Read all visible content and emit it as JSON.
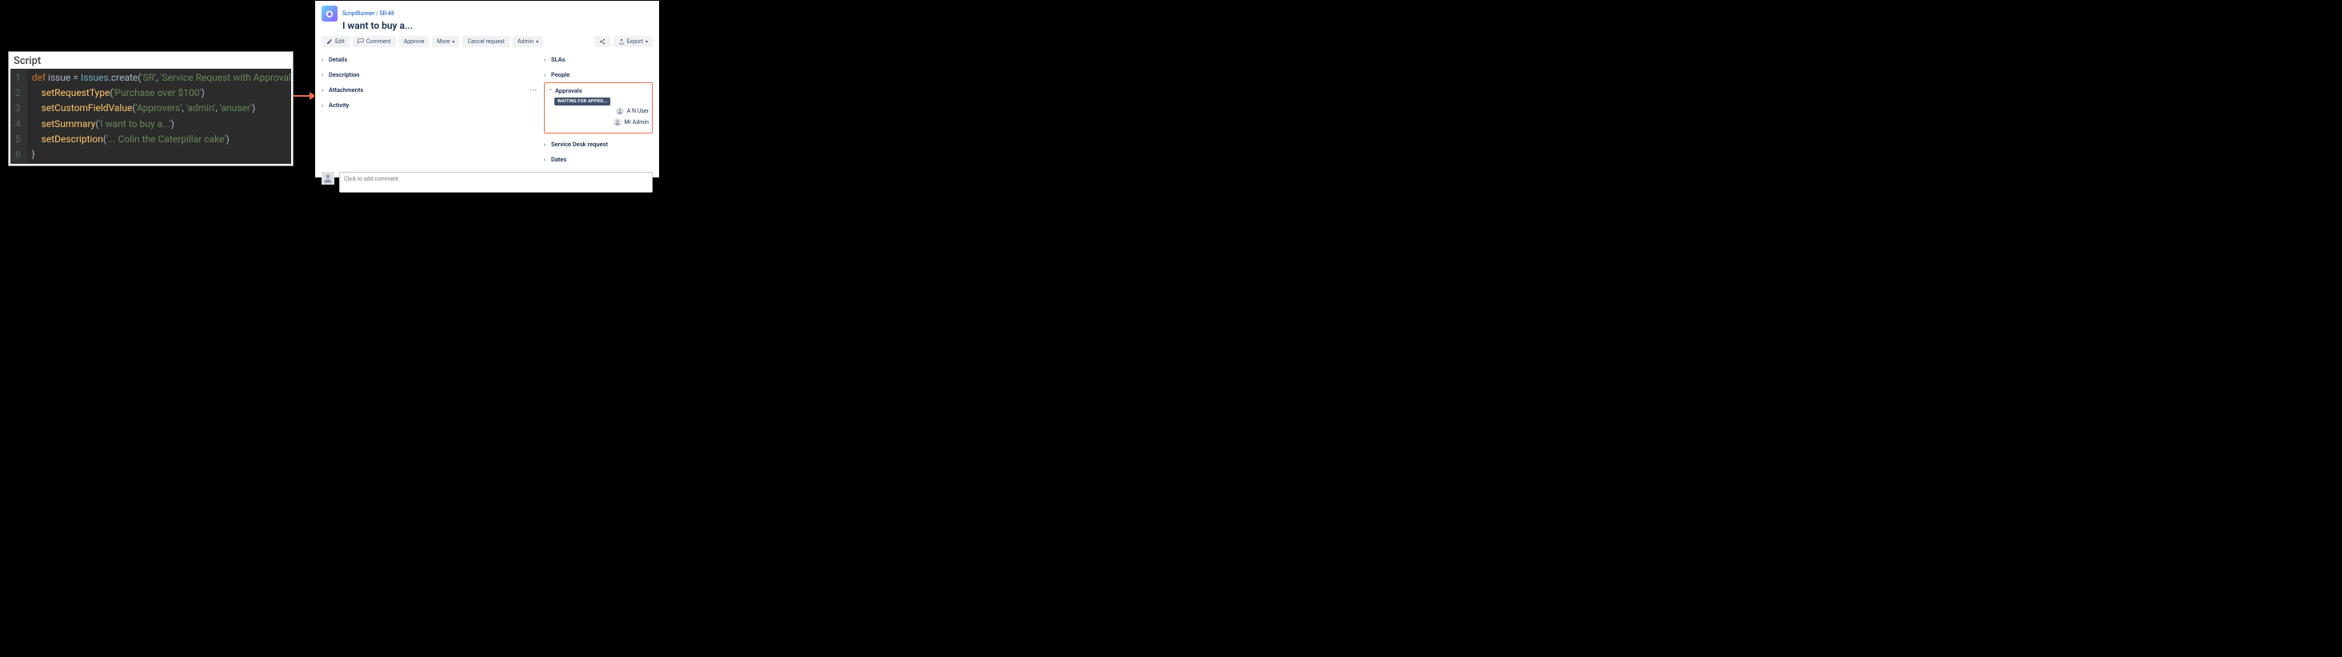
{
  "code_panel": {
    "header": "Script",
    "lines": [
      {
        "n": "1",
        "tokens": [
          {
            "t": "def ",
            "c": "kw"
          },
          {
            "t": "issue = "
          },
          {
            "t": "Issues",
            "c": "type"
          },
          {
            "t": ".create("
          },
          {
            "t": "'SR'",
            "c": "str"
          },
          {
            "t": ", "
          },
          {
            "t": "'Service Request with Approvals'",
            "c": "str"
          },
          {
            "t": ") {"
          }
        ]
      },
      {
        "n": "2",
        "tokens": [
          {
            "t": "    "
          },
          {
            "t": "setRequestType",
            "c": "fn"
          },
          {
            "t": "("
          },
          {
            "t": "'Purchase over $100'",
            "c": "str"
          },
          {
            "t": ")"
          }
        ]
      },
      {
        "n": "3",
        "tokens": [
          {
            "t": "    "
          },
          {
            "t": "setCustomFieldValue",
            "c": "fn"
          },
          {
            "t": "("
          },
          {
            "t": "'Approvers'",
            "c": "str"
          },
          {
            "t": ", "
          },
          {
            "t": "'admin'",
            "c": "str"
          },
          {
            "t": ", "
          },
          {
            "t": "'anuser'",
            "c": "str"
          },
          {
            "t": ")"
          }
        ]
      },
      {
        "n": "4",
        "tokens": [
          {
            "t": "    "
          },
          {
            "t": "setSummary",
            "c": "fn"
          },
          {
            "t": "("
          },
          {
            "t": "'I want to buy a...'",
            "c": "str"
          },
          {
            "t": ")"
          }
        ]
      },
      {
        "n": "5",
        "tokens": [
          {
            "t": "    "
          },
          {
            "t": "setDescription",
            "c": "fn"
          },
          {
            "t": "("
          },
          {
            "t": "'... Colin the Caterpillar cake'",
            "c": "str"
          },
          {
            "t": ")"
          }
        ]
      },
      {
        "n": "6",
        "tokens": [
          {
            "t": "}"
          }
        ]
      }
    ]
  },
  "jira": {
    "breadcrumb": {
      "project": "ScriptRunner",
      "sep": "/",
      "key": "SR-48"
    },
    "title": "I want to buy a...",
    "toolbar": {
      "edit": "Edit",
      "comment": "Comment",
      "approve": "Approve",
      "more": "More",
      "cancel": "Cancel request",
      "admin": "Admin",
      "export": "Export"
    },
    "main_sections": {
      "details": "Details",
      "description": "Description",
      "attachments": "Attachments",
      "activity": "Activity"
    },
    "side_sections": {
      "slas": "SLAs",
      "people": "People",
      "approvals": "Approvals",
      "service_desk": "Service Desk request",
      "dates": "Dates"
    },
    "approvals": {
      "status": "WAITING FOR APPRO...",
      "users": [
        "A N User",
        "Mr Admin"
      ]
    },
    "comment_placeholder": "Click to add comment"
  }
}
